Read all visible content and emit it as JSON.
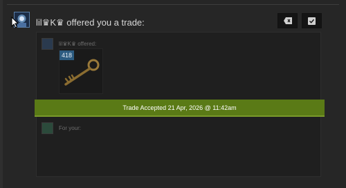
{
  "notification": {
    "title": "lil♛K♛ offered you a trade:",
    "offered_label": "lil♛K♛ offered:",
    "for_your_label": "For your:",
    "status_banner": "Trade Accepted 21 Apr, 2026 @ 11:42am"
  },
  "item": {
    "count_badge": "418",
    "icon": "key-icon"
  },
  "actions": {
    "decline_icon": "backspace-icon",
    "accept_icon": "checkbox-icon"
  },
  "colors": {
    "background": "#262626",
    "panel": "#1f1f1f",
    "banner": "#5a7a16",
    "badge": "#2c5b80"
  }
}
